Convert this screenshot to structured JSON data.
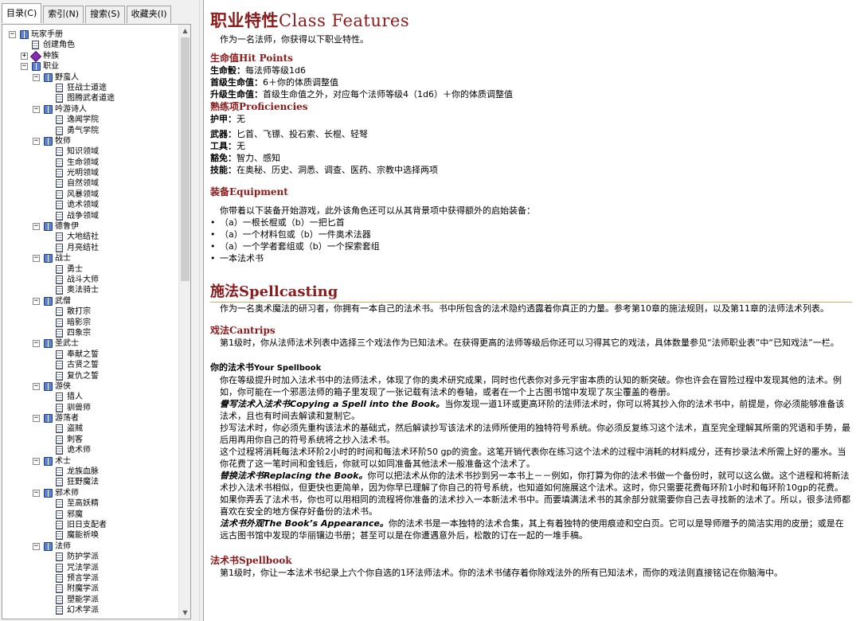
{
  "nav": {
    "tabs": [
      {
        "label": "目录(C)",
        "active": true
      },
      {
        "label": "索引(N)",
        "active": false
      },
      {
        "label": "搜索(S)",
        "active": false
      },
      {
        "label": "收藏夹(I)",
        "active": false
      }
    ],
    "tree": [
      {
        "label": "玩家手册",
        "level": 0,
        "icon": "book",
        "expander": "minus"
      },
      {
        "label": "创建角色",
        "level": 1,
        "icon": "page",
        "expander": ""
      },
      {
        "label": "种族",
        "level": 1,
        "icon": "gem",
        "expander": "plus"
      },
      {
        "label": "职业",
        "level": 1,
        "icon": "book",
        "expander": "minus"
      },
      {
        "label": "野蛮人",
        "level": 2,
        "icon": "book",
        "expander": "minus"
      },
      {
        "label": "狂战士道途",
        "level": 3,
        "icon": "page",
        "expander": ""
      },
      {
        "label": "图腾武者道途",
        "level": 3,
        "icon": "page",
        "expander": ""
      },
      {
        "label": "吟游诗人",
        "level": 2,
        "icon": "book",
        "expander": "minus"
      },
      {
        "label": "逸闻学院",
        "level": 3,
        "icon": "page",
        "expander": ""
      },
      {
        "label": "勇气学院",
        "level": 3,
        "icon": "page",
        "expander": ""
      },
      {
        "label": "牧师",
        "level": 2,
        "icon": "book",
        "expander": "minus"
      },
      {
        "label": "知识领域",
        "level": 3,
        "icon": "page",
        "expander": ""
      },
      {
        "label": "生命领域",
        "level": 3,
        "icon": "page",
        "expander": ""
      },
      {
        "label": "光明领域",
        "level": 3,
        "icon": "page",
        "expander": ""
      },
      {
        "label": "自然领域",
        "level": 3,
        "icon": "page",
        "expander": ""
      },
      {
        "label": "风暴领域",
        "level": 3,
        "icon": "page",
        "expander": ""
      },
      {
        "label": "诡术领域",
        "level": 3,
        "icon": "page",
        "expander": ""
      },
      {
        "label": "战争领域",
        "level": 3,
        "icon": "page",
        "expander": ""
      },
      {
        "label": "德鲁伊",
        "level": 2,
        "icon": "book",
        "expander": "minus"
      },
      {
        "label": "大地结社",
        "level": 3,
        "icon": "page",
        "expander": ""
      },
      {
        "label": "月亮结社",
        "level": 3,
        "icon": "page",
        "expander": ""
      },
      {
        "label": "战士",
        "level": 2,
        "icon": "book",
        "expander": "minus"
      },
      {
        "label": "勇士",
        "level": 3,
        "icon": "page",
        "expander": ""
      },
      {
        "label": "战斗大师",
        "level": 3,
        "icon": "page",
        "expander": ""
      },
      {
        "label": "奥法骑士",
        "level": 3,
        "icon": "page",
        "expander": ""
      },
      {
        "label": "武僧",
        "level": 2,
        "icon": "book",
        "expander": "minus"
      },
      {
        "label": "散打宗",
        "level": 3,
        "icon": "page",
        "expander": ""
      },
      {
        "label": "暗影宗",
        "level": 3,
        "icon": "page",
        "expander": ""
      },
      {
        "label": "四象宗",
        "level": 3,
        "icon": "page",
        "expander": ""
      },
      {
        "label": "圣武士",
        "level": 2,
        "icon": "book",
        "expander": "minus"
      },
      {
        "label": "奉献之誓",
        "level": 3,
        "icon": "page",
        "expander": ""
      },
      {
        "label": "古贤之誓",
        "level": 3,
        "icon": "page",
        "expander": ""
      },
      {
        "label": "复仇之誓",
        "level": 3,
        "icon": "page",
        "expander": ""
      },
      {
        "label": "游侠",
        "level": 2,
        "icon": "book",
        "expander": "minus"
      },
      {
        "label": "猎人",
        "level": 3,
        "icon": "page",
        "expander": ""
      },
      {
        "label": "驯兽师",
        "level": 3,
        "icon": "page",
        "expander": ""
      },
      {
        "label": "游荡者",
        "level": 2,
        "icon": "book",
        "expander": "minus"
      },
      {
        "label": "盗贼",
        "level": 3,
        "icon": "page",
        "expander": ""
      },
      {
        "label": "刺客",
        "level": 3,
        "icon": "page",
        "expander": ""
      },
      {
        "label": "诡术师",
        "level": 3,
        "icon": "page",
        "expander": ""
      },
      {
        "label": "术士",
        "level": 2,
        "icon": "book",
        "expander": "minus"
      },
      {
        "label": "龙族血脉",
        "level": 3,
        "icon": "page",
        "expander": ""
      },
      {
        "label": "狂野魔法",
        "level": 3,
        "icon": "page",
        "expander": ""
      },
      {
        "label": "邪术师",
        "level": 2,
        "icon": "book",
        "expander": "minus"
      },
      {
        "label": "至高妖精",
        "level": 3,
        "icon": "page",
        "expander": ""
      },
      {
        "label": "邪魔",
        "level": 3,
        "icon": "page",
        "expander": ""
      },
      {
        "label": "旧日支配者",
        "level": 3,
        "icon": "page",
        "expander": ""
      },
      {
        "label": "魔能祈唤",
        "level": 3,
        "icon": "page",
        "expander": ""
      },
      {
        "label": "法师",
        "level": 2,
        "icon": "book",
        "expander": "minus"
      },
      {
        "label": "防护学派",
        "level": 3,
        "icon": "page",
        "expander": ""
      },
      {
        "label": "咒法学派",
        "level": 3,
        "icon": "page",
        "expander": ""
      },
      {
        "label": "预言学派",
        "level": 3,
        "icon": "page",
        "expander": ""
      },
      {
        "label": "附魔学派",
        "level": 3,
        "icon": "page",
        "expander": ""
      },
      {
        "label": "塑能学派",
        "level": 3,
        "icon": "page",
        "expander": ""
      },
      {
        "label": "幻术学派",
        "level": 3,
        "icon": "page",
        "expander": ""
      }
    ]
  },
  "article": {
    "title_cn": "职业特性",
    "title_en": "Class Features",
    "intro": "作为一名法师，你获得以下职业特性。",
    "hp": {
      "heading": "生命值Hit Points",
      "rows": [
        {
          "label": "生命骰：",
          "text": "每法师等级1d6"
        },
        {
          "label": "首级生命值：",
          "text": "6＋你的体质调整值"
        },
        {
          "label": "升级生命值：",
          "text": "首级生命值之外，对应每个法师等级4（1d6）＋你的体质调整值"
        }
      ]
    },
    "prof": {
      "heading": "熟练项Proficiencies",
      "armor": {
        "label": "护甲：",
        "text": "无"
      },
      "rows": [
        {
          "label": "武器：",
          "text": "匕首、飞镖、投石索、长棍、轻弩"
        },
        {
          "label": "工具：",
          "text": "无"
        },
        {
          "label": "豁免：",
          "text": "智力、感知"
        },
        {
          "label": "技能：",
          "text": "在奥秘、历史、洞悉、调查、医药、宗教中选择两项"
        }
      ]
    },
    "equip": {
      "heading": "装备Equipment",
      "intro": "你带着以下装备开始游戏，此外该角色还可以从其背景项中获得额外的启始装备：",
      "items": [
        "（a）一根长棍或（b）一把匕首",
        "（a）一个材料包或（b）一件奥术法器",
        "（a）一个学者套组或（b）一个探索套组",
        "一本法术书"
      ]
    },
    "spellcasting": {
      "heading_cn": "施法",
      "heading_en": "Spellcasting",
      "intro": "作为一名奥术魔法的研习者，你拥有一本自己的法术书。书中所包含的法术隐约透露着你真正的力量。参考第10章的施法规则，以及第11章的法师法术列表。",
      "cantrips": {
        "heading": "戏法Cantrips",
        "text": "第1级时，你从法师法术列表中选择三个戏法作为已知法术。在获得更高的法师等级后你还可以习得其它的戏法，具体数量参见“法师职业表”中“已知戏法”一栏。"
      },
      "yourbook": {
        "heading_cn": "你的法术书",
        "heading_en": "Your Spellbook",
        "p1": "你在等级提升时加入法术书中的法师法术，体现了你的奥术研究成果，同时也代表你对多元宇宙本质的认知的新突破。你也许会在冒险过程中发现其他的法术。例如，你可能在一个邪恶法师的箱子里发现了一张记载有法术的卷轴，或者在一个上古图书馆中发现了灰尘覆盖的卷册。",
        "copy_label": "誊写法术入法术书Copying a Spell into the Book。",
        "copy_text": "当你发现一道1环或更高环阶的法师法术时，你可以将其抄入你的法术书中，前提是，你必须能够准备该法术，且也有时间去解读和复制它。",
        "p3": "抄写法术时，你必须先重构该法术的基础式，然后解读抄写该法术的法师所使用的独特符号系统。你必须反复练习这个法术，直至完全理解其所需的咒语和手势，最后用再用你自己的符号系统将之抄入法术书。",
        "p4": "这个过程将消耗每法术环阶2小时的时间和每法术环阶50 gp的资金。这笔开销代表你在练习这个法术的过程中消耗的材料成分，还有抄录法术所需上好的墨水。当你花费了这一笔时间和金钱后，你就可以如同准备其他法术一般准备这个法术了。",
        "replace_label": "替换法术书Replacing the Book。",
        "replace_text": "你可以把法术从你的法术书抄到另一本书上－－例如，你打算为你的法术书做一个备份时，就可以这么做。这个进程和将新法术抄入法术书相似，但更快也更简单，因为你早已理解了你自己的符号系统，也知道如何施展这个法术。这时，你只需要花费每环阶1小时和每环阶10gp的花费。",
        "p6": "如果你弄丢了法术书，你也可以用相同的流程将你准备的法术抄入一本新法术书中。而要填满法术书的其余部分就需要你自己去寻找新的法术了。所以，很多法师都喜欢在安全的地方保存好备份的法术书。",
        "look_label": "法术书外观The Book’s Appearance。",
        "look_text": "你的法术书是一本独特的法术合集，其上有着独特的使用痕迹和空白页。它可以是导师赠予的简洁实用的皮册；或是在远古图书馆中发现的华丽镶边书册；甚至可以是在你遭遇意外后，松散的订在一起的一堆手稿。"
      },
      "spellbook": {
        "heading": "法术书Spellbook",
        "text": "第1级时，你让一本法术书纪录上六个你自选的1环法师法术。你的法术书储存着你除戏法外的所有已知法术，而你的戏法则直接铭记在你脑海中。"
      }
    }
  }
}
